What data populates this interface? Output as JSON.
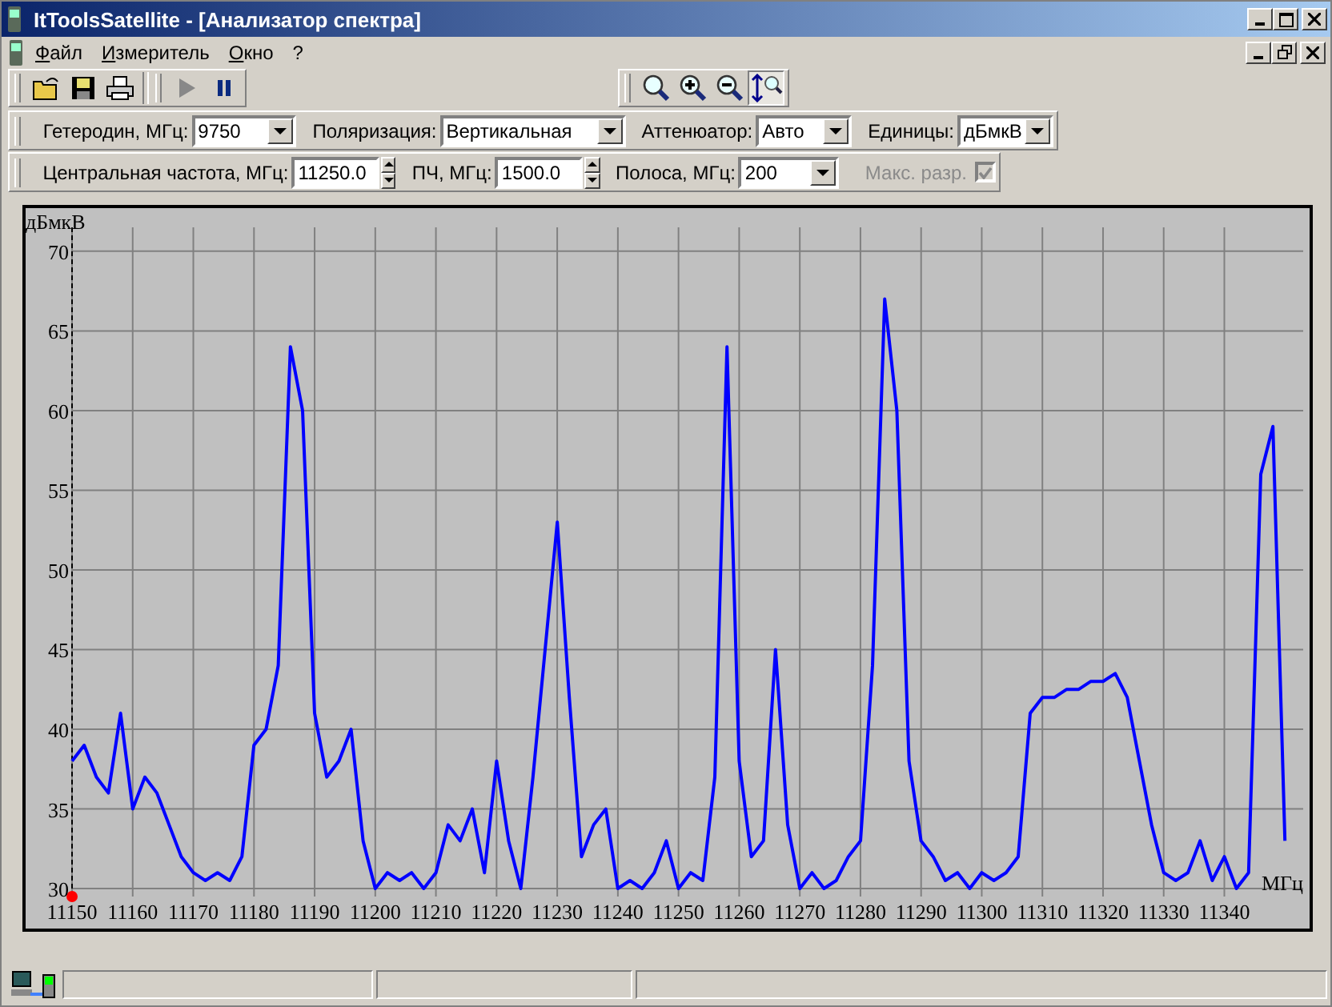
{
  "window": {
    "title": "ItToolsSatellite - [Анализатор спектра]"
  },
  "menu": [
    "Файл",
    "Измеритель",
    "Окно",
    "?"
  ],
  "toolbar": {
    "playback": [
      {
        "kind": "play",
        "disabled": true
      },
      {
        "kind": "pause",
        "disabled": false
      }
    ],
    "zoom_tools": [
      {
        "kind": "zoom",
        "selected": false
      },
      {
        "kind": "zoom-in",
        "selected": false
      },
      {
        "kind": "zoom-out",
        "selected": false
      },
      {
        "kind": "zoom-vertical",
        "selected": true
      }
    ]
  },
  "settings_row_1": [
    {
      "kind": "combo",
      "label": "Гетеродин, МГц:",
      "value": "9750"
    },
    {
      "kind": "combo",
      "label": "Поляризация:",
      "value": "Вертикальная"
    },
    {
      "kind": "combo",
      "label": "Аттенюатор:",
      "value": "Авто"
    },
    {
      "kind": "combo",
      "label": "Единицы:",
      "value": "дБмкВ"
    }
  ],
  "settings_row_2": [
    {
      "kind": "spin",
      "label": "Центральная частота, МГц:",
      "value": "11250.0"
    },
    {
      "kind": "spin",
      "label": "ПЧ, МГц:",
      "value": "1500.0"
    },
    {
      "kind": "combo",
      "label": "Полоса, МГц:",
      "value": "200"
    },
    {
      "kind": "check",
      "label": "Макс. разр.",
      "checked": true,
      "disabled": true
    }
  ],
  "chart": {
    "chart_data": {
      "type": "line",
      "grid": true,
      "ylabel": "дБмкВ",
      "xlabel": "МГц",
      "xticks": [
        11150,
        11160,
        11170,
        11180,
        11190,
        11200,
        11210,
        11220,
        11230,
        11240,
        11250,
        11260,
        11270,
        11280,
        11290,
        11300,
        11310,
        11320,
        11330,
        11340
      ],
      "yticks": [
        30,
        35,
        40,
        45,
        50,
        55,
        60,
        65,
        70
      ],
      "xlim": [
        11150,
        11353
      ],
      "ylim": [
        29.5,
        71.5
      ],
      "x": [
        11150,
        11152,
        11154,
        11156,
        11158,
        11160,
        11162,
        11164,
        11166,
        11168,
        11170,
        11172,
        11174,
        11176,
        11178,
        11180,
        11182,
        11184,
        11186,
        11188,
        11190,
        11192,
        11194,
        11196,
        11198,
        11200,
        11202,
        11204,
        11206,
        11208,
        11210,
        11212,
        11214,
        11216,
        11218,
        11220,
        11222,
        11224,
        11226,
        11228,
        11230,
        11232,
        11234,
        11236,
        11238,
        11240,
        11242,
        11244,
        11246,
        11248,
        11250,
        11252,
        11254,
        11256,
        11258,
        11260,
        11262,
        11264,
        11266,
        11268,
        11270,
        11272,
        11274,
        11276,
        11278,
        11280,
        11282,
        11284,
        11286,
        11288,
        11290,
        11292,
        11294,
        11296,
        11298,
        11300,
        11302,
        11304,
        11306,
        11308,
        11310,
        11312,
        11314,
        11316,
        11318,
        11320,
        11322,
        11324,
        11326,
        11328,
        11330,
        11332,
        11334,
        11336,
        11338,
        11340,
        11342,
        11344,
        11346,
        11348,
        11350
      ],
      "series": [
        {
          "color": "#0000ff",
          "values": [
            38,
            39,
            37,
            36,
            41,
            35,
            37,
            36,
            34,
            32,
            31,
            30.5,
            31,
            30.5,
            32,
            39,
            40,
            44,
            64,
            60,
            41,
            37,
            38,
            40,
            33,
            30,
            31,
            30.5,
            31,
            30,
            31,
            34,
            33,
            35,
            31,
            38,
            33,
            30,
            37,
            45,
            53,
            42,
            32,
            34,
            35,
            30,
            30.5,
            30,
            31,
            33,
            30,
            31,
            30.5,
            37,
            64,
            38,
            32,
            33,
            45,
            34,
            30,
            31,
            30,
            30.5,
            32,
            33,
            44,
            67,
            60,
            38,
            33,
            32,
            30.5,
            31,
            30,
            31,
            30.5,
            31,
            32,
            41,
            42,
            42,
            42.5,
            42.5,
            43,
            43,
            43.5,
            42,
            38,
            34,
            31,
            30.5,
            31,
            33,
            30.5,
            32,
            30,
            31,
            56,
            59,
            33
          ]
        }
      ]
    }
  },
  "status_bar": {
    "connected": true
  }
}
